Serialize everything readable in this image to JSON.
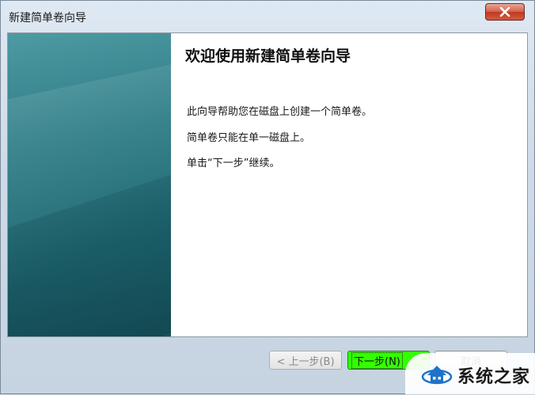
{
  "window": {
    "title": "新建简单卷向导",
    "close_icon": "close-icon"
  },
  "content": {
    "heading": "欢迎使用新建简单卷向导",
    "line1": "此向导帮助您在磁盘上创建一个简单卷。",
    "line2": "简单卷只能在单一磁盘上。",
    "line3": "单击“下一步”继续。"
  },
  "buttons": {
    "back": "< 上一步(B)",
    "next": "下一步(N)",
    "cancel": "取消"
  },
  "watermark": {
    "text": "系统之家",
    "icon": "house-logo-icon"
  },
  "colors": {
    "side_panel": "#1f6d77",
    "next_highlight": "#33ff00"
  }
}
